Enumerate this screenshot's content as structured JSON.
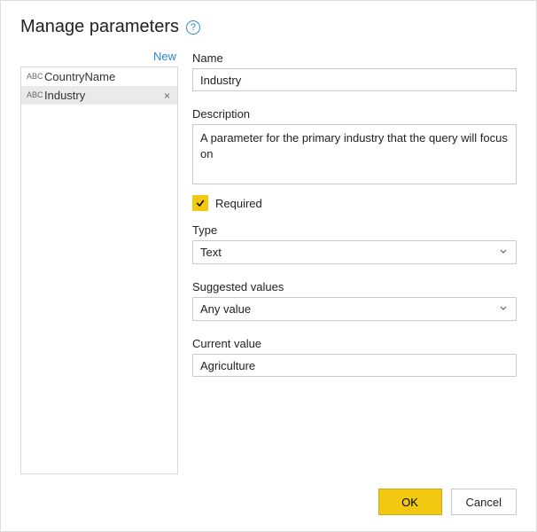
{
  "header": {
    "title": "Manage parameters",
    "help_icon": "?"
  },
  "left": {
    "new_label": "New",
    "type_glyph": "ABC",
    "items": [
      {
        "label": "CountryName",
        "selected": false
      },
      {
        "label": "Industry",
        "selected": true
      }
    ],
    "delete_glyph": "×"
  },
  "form": {
    "name_label": "Name",
    "name_value": "Industry",
    "description_label": "Description",
    "description_value": "A parameter for the primary industry that the query will focus on",
    "required_label": "Required",
    "required_checked": true,
    "type_label": "Type",
    "type_value": "Text",
    "suggested_label": "Suggested values",
    "suggested_value": "Any value",
    "current_label": "Current value",
    "current_value": "Agriculture"
  },
  "footer": {
    "ok_label": "OK",
    "cancel_label": "Cancel"
  }
}
